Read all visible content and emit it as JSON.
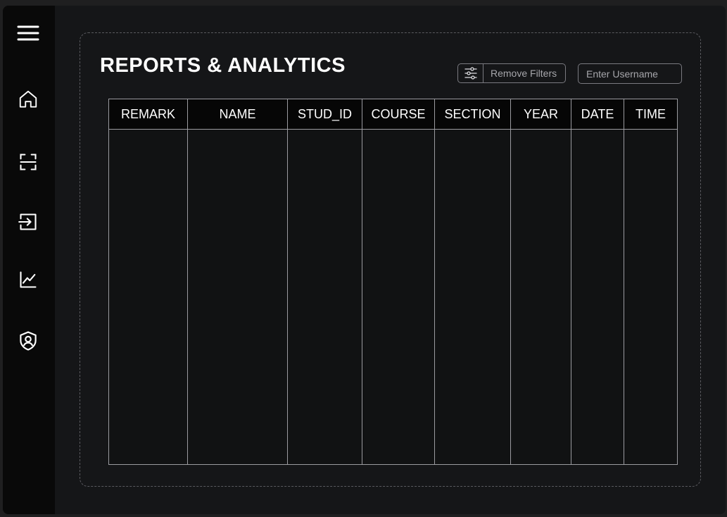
{
  "sidebar": {
    "items": [
      {
        "icon": "menu-icon"
      },
      {
        "icon": "home-icon"
      },
      {
        "icon": "scan-icon"
      },
      {
        "icon": "login-icon"
      },
      {
        "icon": "analytics-icon"
      },
      {
        "icon": "admin-shield-icon"
      }
    ]
  },
  "page": {
    "title": "REPORTS & ANALYTICS"
  },
  "toolbar": {
    "filter_icon": "sliders-icon",
    "remove_filters_label": "Remove Filters",
    "username_placeholder": "Enter Username",
    "username_value": ""
  },
  "table": {
    "columns": [
      "REMARK",
      "NAME",
      "STUD_ID",
      "COURSE",
      "SECTION",
      "YEAR",
      "DATE",
      "TIME"
    ],
    "rows": []
  },
  "colors": {
    "background": "#151618",
    "sidebar": "#090909",
    "text": "#ffffff",
    "muted": "#a6a6ab",
    "border": "#9b9ba0"
  }
}
